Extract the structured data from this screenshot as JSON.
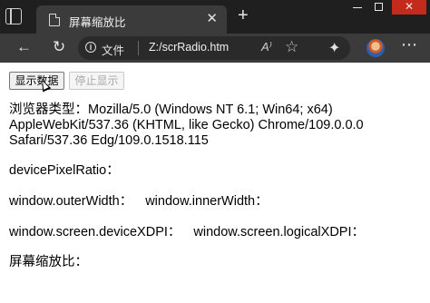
{
  "browser": {
    "tab_title": "屏幕缩放比",
    "tab_close": "✕",
    "new_tab": "+",
    "address": {
      "scheme_label": "文件",
      "url": "Z:/scrRadio.htm"
    },
    "readaloud": "A⁾",
    "window_close": "✕"
  },
  "page": {
    "buttons": {
      "show": "显示数据",
      "stop": "停止显示"
    },
    "ua_label": "浏览器类型：",
    "ua_value_line1": "Mozilla/5.0 (Windows NT 6.1; Win64; x64)",
    "ua_value_line2": "AppleWebKit/537.36 (KHTML, like Gecko) Chrome/109.0.0.0",
    "ua_value_line3": "Safari/537.36 Edg/109.0.1518.115",
    "device_pixel_ratio_label": "devicePixelRatio：",
    "outer_width_label": "window.outerWidth：",
    "inner_width_label": "window.innerWidth：",
    "device_xdpi_label": "window.screen.deviceXDPI：",
    "logical_xdpi_label": "window.screen.logicalXDPI：",
    "zoom_label": "屏幕缩放比："
  },
  "icons": {
    "tab_strip": "tab-strip-icon",
    "page": "page-icon",
    "back": "arrow-left-icon",
    "reload": "reload-icon",
    "info": "info-icon",
    "favorite": "star-plus-icon",
    "extensions": "puzzle-icon",
    "menu": "ellipsis-icon"
  },
  "colors": {
    "titlebar": "#1f1f1f",
    "toolbar": "#3b3b3b",
    "close_button": "#c42b1c"
  }
}
